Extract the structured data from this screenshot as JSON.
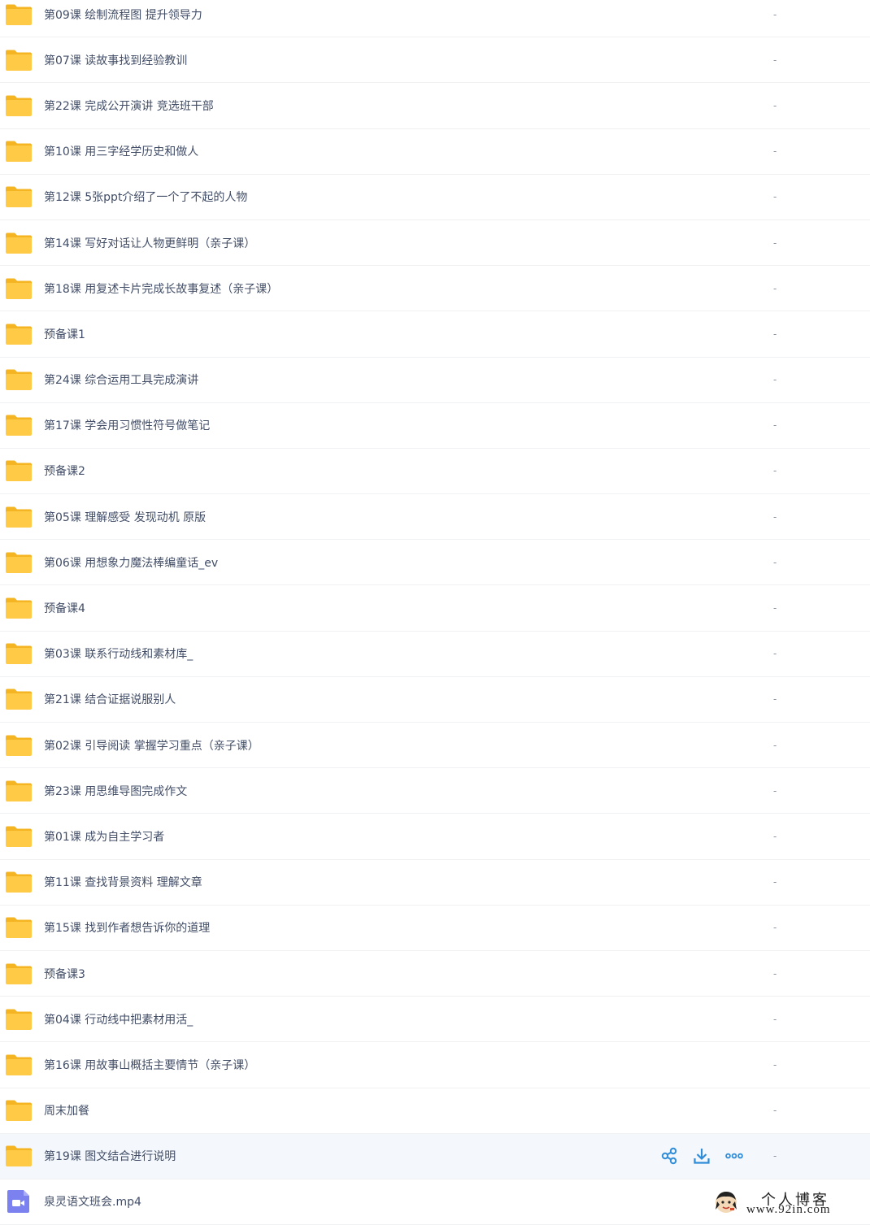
{
  "files": [
    {
      "name": "第09课 绘制流程图 提升领导力",
      "size": "-",
      "type": "folder"
    },
    {
      "name": "第07课 读故事找到经验教训",
      "size": "-",
      "type": "folder"
    },
    {
      "name": "第22课 完成公开演讲 竞选班干部",
      "size": "-",
      "type": "folder"
    },
    {
      "name": "第10课 用三字经学历史和做人",
      "size": "-",
      "type": "folder"
    },
    {
      "name": "第12课 5张ppt介绍了一个了不起的人物",
      "size": "-",
      "type": "folder"
    },
    {
      "name": "第14课 写好对话让人物更鲜明（亲子课）",
      "size": "-",
      "type": "folder"
    },
    {
      "name": "第18课 用复述卡片完成长故事复述（亲子课）",
      "size": "-",
      "type": "folder"
    },
    {
      "name": "预备课1",
      "size": "-",
      "type": "folder"
    },
    {
      "name": "第24课 综合运用工具完成演讲",
      "size": "-",
      "type": "folder"
    },
    {
      "name": "第17课 学会用习惯性符号做笔记",
      "size": "-",
      "type": "folder"
    },
    {
      "name": "预备课2",
      "size": "-",
      "type": "folder"
    },
    {
      "name": "第05课 理解感受 发现动机 原版",
      "size": "-",
      "type": "folder"
    },
    {
      "name": "第06课 用想象力魔法棒编童话_ev",
      "size": "-",
      "type": "folder"
    },
    {
      "name": "预备课4",
      "size": "-",
      "type": "folder"
    },
    {
      "name": "第03课 联系行动线和素材库_",
      "size": "-",
      "type": "folder"
    },
    {
      "name": "第21课 结合证据说服别人",
      "size": "-",
      "type": "folder"
    },
    {
      "name": "第02课 引导阅读 掌握学习重点（亲子课）",
      "size": "-",
      "type": "folder"
    },
    {
      "name": "第23课 用思维导图完成作文",
      "size": "-",
      "type": "folder"
    },
    {
      "name": "第01课 成为自主学习者",
      "size": "-",
      "type": "folder"
    },
    {
      "name": "第11课 查找背景资料 理解文章",
      "size": "-",
      "type": "folder"
    },
    {
      "name": "第15课 找到作者想告诉你的道理",
      "size": "-",
      "type": "folder"
    },
    {
      "name": "预备课3",
      "size": "-",
      "type": "folder"
    },
    {
      "name": "第04课 行动线中把素材用活_",
      "size": "-",
      "type": "folder"
    },
    {
      "name": "第16课 用故事山概括主要情节（亲子课）",
      "size": "-",
      "type": "folder"
    },
    {
      "name": "周末加餐",
      "size": "-",
      "type": "folder"
    },
    {
      "name": "第19课 图文结合进行说明",
      "size": "-",
      "type": "folder",
      "hovered": true
    },
    {
      "name": "泉灵语文班会.mp4",
      "size": "",
      "type": "video"
    }
  ],
  "hover_actions": [
    {
      "icon": "share-icon"
    },
    {
      "icon": "download-icon"
    },
    {
      "icon": "more-icon"
    }
  ],
  "watermark": {
    "cn": "个人博客",
    "url": "www.92in.com"
  },
  "colors": {
    "folder": "#ffcb47",
    "folder_tab": "#f5b523",
    "video": "#7b82f0",
    "text": "#424e67",
    "action": "#2e8cd8",
    "hover_bg": "#f4f8fd"
  }
}
